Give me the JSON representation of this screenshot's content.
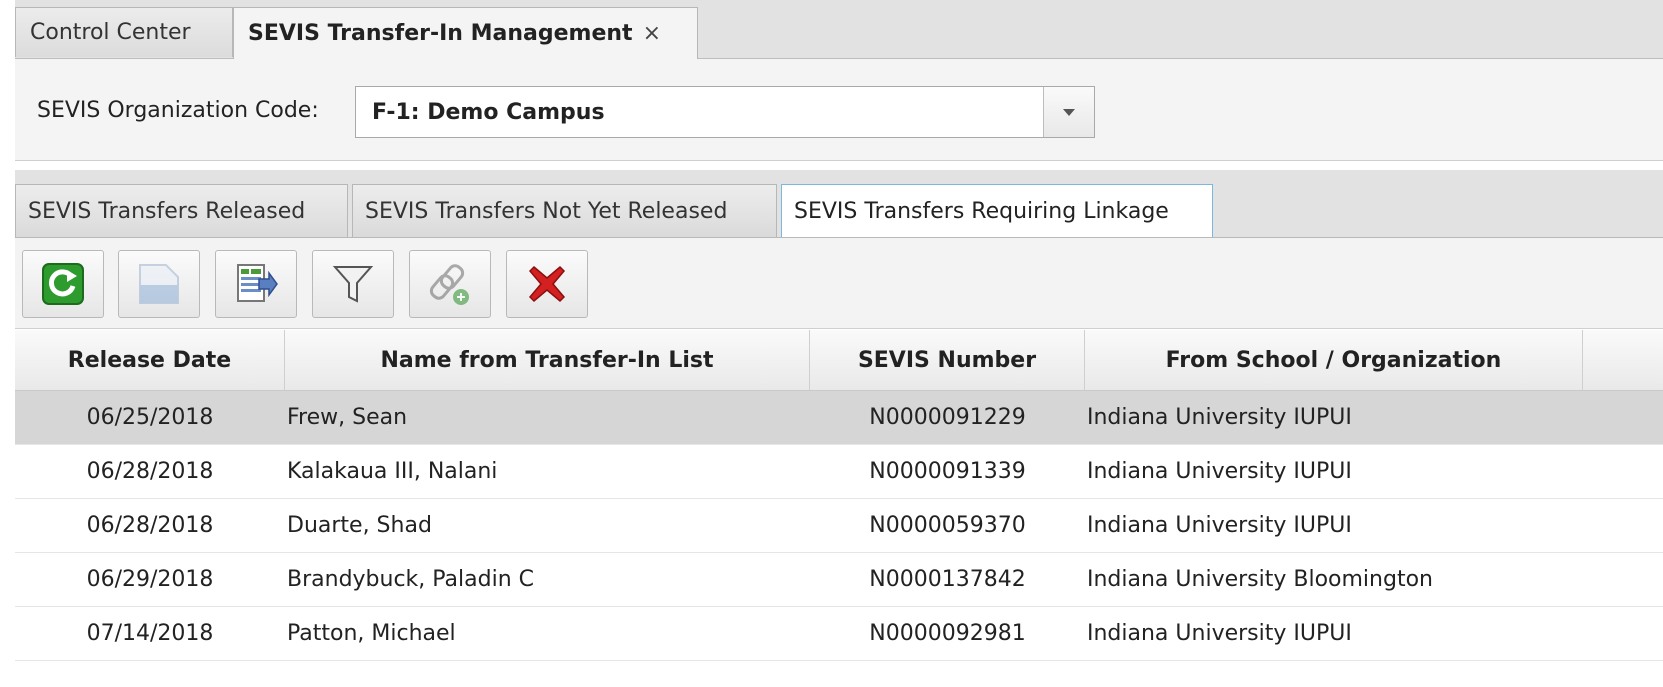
{
  "window_tabs": [
    {
      "label": "Control Center",
      "active": false
    },
    {
      "label": "SEVIS Transfer-In Management",
      "active": true,
      "close_glyph": "×"
    }
  ],
  "org": {
    "label": "SEVIS Organization Code:",
    "selected": "F-1: Demo Campus"
  },
  "sub_tabs": [
    {
      "label": "SEVIS Transfers Released",
      "active": false
    },
    {
      "label": "SEVIS Transfers Not Yet Released",
      "active": false
    },
    {
      "label": "SEVIS Transfers Requiring Linkage",
      "active": true
    }
  ],
  "toolbar": {
    "buttons": [
      {
        "icon": "refresh-icon",
        "enabled": true
      },
      {
        "icon": "open-document-icon",
        "enabled": false
      },
      {
        "icon": "export-spreadsheet-icon",
        "enabled": true
      },
      {
        "icon": "filter-icon",
        "enabled": true
      },
      {
        "icon": "link-add-icon",
        "enabled": false
      },
      {
        "icon": "delete-icon",
        "enabled": true
      }
    ],
    "colors": {
      "refresh": "#2e9b2e",
      "delete": "#d42020"
    }
  },
  "table": {
    "columns": [
      "Release Date",
      "Name from Transfer-In List",
      "SEVIS Number",
      "From School / Organization"
    ],
    "rows": [
      {
        "date": "06/25/2018",
        "name": "Frew, Sean",
        "sevis": "N0000091229",
        "school": "Indiana University IUPUI",
        "selected": true
      },
      {
        "date": "06/28/2018",
        "name": "Kalakaua III, Nalani",
        "sevis": "N0000091339",
        "school": "Indiana University IUPUI",
        "selected": false
      },
      {
        "date": "06/28/2018",
        "name": "Duarte, Shad",
        "sevis": "N0000059370",
        "school": "Indiana University IUPUI",
        "selected": false
      },
      {
        "date": "06/29/2018",
        "name": "Brandybuck, Paladin C",
        "sevis": "N0000137842",
        "school": "Indiana University Bloomington",
        "selected": false
      },
      {
        "date": "07/14/2018",
        "name": "Patton, Michael",
        "sevis": "N0000092981",
        "school": "Indiana University IUPUI",
        "selected": false
      }
    ]
  }
}
